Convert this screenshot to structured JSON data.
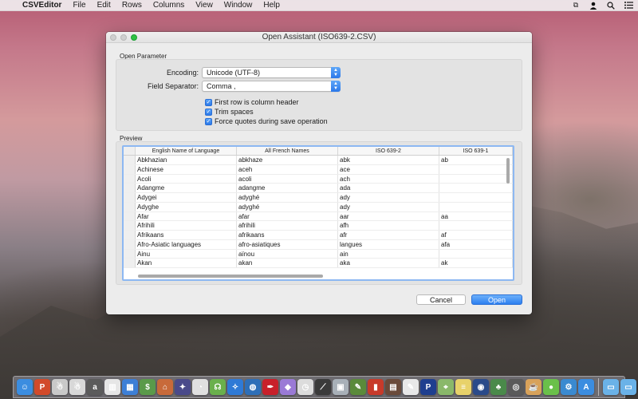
{
  "menubar": {
    "apple": "",
    "app_name": "CSVEditor",
    "items": [
      "File",
      "Edit",
      "Rows",
      "Columns",
      "View",
      "Window",
      "Help"
    ]
  },
  "window": {
    "title": "Open Assistant (ISO639-2.CSV)"
  },
  "open_parameter": {
    "section_label": "Open Parameter",
    "encoding_label": "Encoding:",
    "encoding_value": "Unicode (UTF-8)",
    "separator_label": "Field Separator:",
    "separator_value": "Comma ,",
    "options": [
      {
        "label": "First row is column header",
        "checked": true
      },
      {
        "label": "Trim spaces",
        "checked": true
      },
      {
        "label": "Force quotes during save operation",
        "checked": true
      }
    ]
  },
  "preview": {
    "section_label": "Preview",
    "columns": [
      "English Name of Language",
      "All French Names",
      "ISO 639-2",
      "ISO 639-1"
    ],
    "rows": [
      [
        "Abkhazian",
        "abkhaze",
        "abk",
        "ab"
      ],
      [
        "Achinese",
        "aceh",
        "ace",
        ""
      ],
      [
        "Acoli",
        "acoli",
        "ach",
        ""
      ],
      [
        "Adangme",
        "adangme",
        "ada",
        ""
      ],
      [
        "Adygei",
        "adyghé",
        "ady",
        ""
      ],
      [
        "Adyghe",
        "adyghé",
        "ady",
        ""
      ],
      [
        "Afar",
        "afar",
        "aar",
        "aa"
      ],
      [
        "Afrihili",
        "afrihili",
        "afh",
        ""
      ],
      [
        "Afrikaans",
        "afrikaans",
        "afr",
        "af"
      ],
      [
        "Afro-Asiatic languages",
        "afro-asiatiques",
        "langues",
        "afa"
      ],
      [
        "Ainu",
        "aïnou",
        "ain",
        ""
      ],
      [
        "Akan",
        "akan",
        "aka",
        "ak"
      ]
    ]
  },
  "buttons": {
    "cancel": "Cancel",
    "open": "Open"
  },
  "dock": {
    "icons": [
      {
        "name": "finder-icon",
        "color": "#3b8de0",
        "glyph": "☺"
      },
      {
        "name": "pdf-app-icon",
        "color": "#d24a2a",
        "glyph": "P"
      },
      {
        "name": "robot-app-icon",
        "color": "#c9c9c9",
        "glyph": "☃"
      },
      {
        "name": "robot2-app-icon",
        "color": "#d8d8d8",
        "glyph": "☃"
      },
      {
        "name": "font-app-icon",
        "color": "#5b5b5b",
        "glyph": "a"
      },
      {
        "name": "barcode-app-icon",
        "color": "#e6e6e6",
        "glyph": "▥"
      },
      {
        "name": "qr-app-icon",
        "color": "#3d7fd6",
        "glyph": "▦"
      },
      {
        "name": "cash-app-icon",
        "color": "#5a9a4a",
        "glyph": "$"
      },
      {
        "name": "store-app-icon",
        "color": "#c86a3a",
        "glyph": "⌂"
      },
      {
        "name": "compass-app-icon",
        "color": "#4a4a8a",
        "glyph": "✦"
      },
      {
        "name": "gauge-app-icon",
        "color": "#e0e0e0",
        "glyph": "◔"
      },
      {
        "name": "ufo-app-icon",
        "color": "#6ab04c",
        "glyph": "☊"
      },
      {
        "name": "safari-app-icon",
        "color": "#2f7ad6",
        "glyph": "✧"
      },
      {
        "name": "globe-app-icon",
        "color": "#2e6fb8",
        "glyph": "◍"
      },
      {
        "name": "quill-app-icon",
        "color": "#c8202a",
        "glyph": "✒"
      },
      {
        "name": "gem-app-icon",
        "color": "#9a7ad6",
        "glyph": "◆"
      },
      {
        "name": "clock-app-icon",
        "color": "#dcdcdc",
        "glyph": "◷"
      },
      {
        "name": "telescope-app-icon",
        "color": "#3a3a3a",
        "glyph": "⟋"
      },
      {
        "name": "photo-app-icon",
        "color": "#a8b0b8",
        "glyph": "▣"
      },
      {
        "name": "palette-app-icon",
        "color": "#5a8a3a",
        "glyph": "✎"
      },
      {
        "name": "matchbox-app-icon",
        "color": "#c83a2a",
        "glyph": "▮"
      },
      {
        "name": "press-app-icon",
        "color": "#6a4a3a",
        "glyph": "▤"
      },
      {
        "name": "pages-app-icon",
        "color": "#e8e8e8",
        "glyph": "✎"
      },
      {
        "name": "paypal-app-icon",
        "color": "#1f3f8f",
        "glyph": "P"
      },
      {
        "name": "map-app-icon",
        "color": "#8ab86a",
        "glyph": "⌖"
      },
      {
        "name": "notes-app-icon",
        "color": "#e8d26a",
        "glyph": "≡"
      },
      {
        "name": "disk-app-icon",
        "color": "#2a4a8a",
        "glyph": "◉"
      },
      {
        "name": "bonsai-app-icon",
        "color": "#4a8a4a",
        "glyph": "♣"
      },
      {
        "name": "eyeball-app-icon",
        "color": "#5a5a5a",
        "glyph": "◎"
      },
      {
        "name": "cup-app-icon",
        "color": "#d8a25a",
        "glyph": "☕"
      },
      {
        "name": "slime-app-icon",
        "color": "#6ac04a",
        "glyph": "●"
      },
      {
        "name": "system-pref-icon",
        "color": "#3a8ad0",
        "glyph": "⚙"
      },
      {
        "name": "appstore-icon",
        "color": "#3b8de0",
        "glyph": "A"
      }
    ],
    "right_icons": [
      {
        "name": "folder-icon",
        "color": "#6ab2e8",
        "glyph": "▭"
      },
      {
        "name": "downloads-icon",
        "color": "#6ab2e8",
        "glyph": "▭"
      },
      {
        "name": "trash-icon",
        "color": "#d8d8d8",
        "glyph": "🗑"
      }
    ]
  }
}
